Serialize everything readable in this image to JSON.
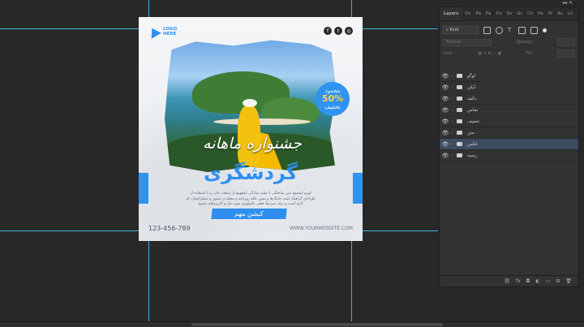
{
  "flyer": {
    "logo_text": "LOGO\nHERE",
    "social_icons": [
      "facebook-icon",
      "twitter-icon",
      "instagram-icon"
    ],
    "badge": {
      "top": "محدود",
      "value": "50%",
      "bottom": "تخفیف"
    },
    "script_title": "جشنواره ماهانه",
    "main_title": "گردشگری",
    "body_text": "لورم ایپسوم متن ساختگی با تولید سادگی نامفهوم از صنعت چاپ و با استفاده از طراحان گرافیک است چاپگرها و متون بلکه روزنامه و مجله در ستون و سطرآنچنان که لازم است و برای شرایط فعلی تکنولوژی مورد نیاز و کاربردهای متنوع",
    "cta_label": "کیشن مهم",
    "phone": "123-456-789",
    "website": "WWW.YOURWEBSITE.COM",
    "accent_color": "#2f8ff0"
  },
  "panel": {
    "tabs": [
      "Layers",
      "Ch",
      "Pa",
      "Pa",
      "Co",
      "Sv",
      "Gr",
      "Ch",
      "Pa",
      "Pr",
      "As",
      "Lil"
    ],
    "filter_label": "Kind",
    "blend_mode": "Normal",
    "opacity_label": "Opacity:",
    "lock_label": "Lock:",
    "fill_label": "Fill:",
    "layers": [
      {
        "name": "لوگو",
        "selected": false
      },
      {
        "name": "آیکن",
        "selected": false
      },
      {
        "name": "دکمه",
        "selected": false
      },
      {
        "name": "تماس",
        "selected": false
      },
      {
        "name": "تخفیف",
        "selected": false
      },
      {
        "name": "متن",
        "selected": false
      },
      {
        "name": "عکس",
        "selected": true
      },
      {
        "name": "زمینه",
        "selected": false
      }
    ],
    "bottom_icons": [
      "link-icon",
      "fx-icon",
      "mask-icon",
      "adjustment-icon",
      "group-folder-icon",
      "new-layer-icon",
      "trash-icon"
    ]
  }
}
